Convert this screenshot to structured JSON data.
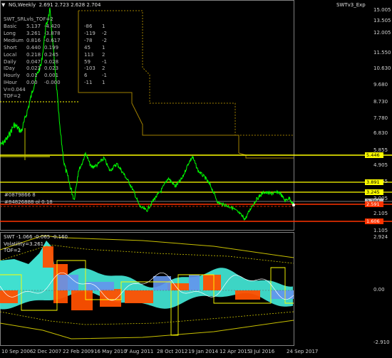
{
  "main_chart": {
    "title": "NG,Weekly  2.691 2.723 2.628 2.704",
    "indicator_label": "SWTv3_Exp",
    "overlay_title": "SWT_SRLvls_TOF=2",
    "stats_rows": [
      {
        "name": "Basic",
        "v1": "5.137",
        "v2": "-4.420",
        "v3": "-86",
        "v4": "1"
      },
      {
        "name": "Long",
        "v1": "3.261",
        "v2": "-3.878",
        "v3": "-119",
        "v4": "-2"
      },
      {
        "name": "Medium",
        "v1": "0.816",
        "v2": "-0.617",
        "v3": "-78",
        "v4": "-2"
      },
      {
        "name": "Short",
        "v1": "0.440",
        "v2": "0.199",
        "v3": "45",
        "v4": "1"
      },
      {
        "name": "Local",
        "v1": "0.218",
        "v2": "0.245",
        "v3": "113",
        "v4": "2"
      },
      {
        "name": "Daily",
        "v1": "0.047",
        "v2": "0.028",
        "v3": "59",
        "v4": "-1"
      },
      {
        "name": "IDay",
        "v1": "0.023",
        "v2": "0.023",
        "v3": "-103",
        "v4": "2"
      },
      {
        "name": "Hourly",
        "v1": "0.01",
        "v2": "0.001",
        "v3": "6",
        "v4": "-1"
      },
      {
        "name": "IHour",
        "v1": "0.00",
        "v2": "-0.000",
        "v3": "-11",
        "v4": "1"
      }
    ],
    "v_label": "V=0.044",
    "tof_label": "TOF=2",
    "cluster_labels": [
      "#0879866 8",
      "#84826888 ol 0.18"
    ],
    "y_ticks": [
      "15.005",
      "13.505",
      "12.005",
      "11.550",
      "10.630",
      "9.680",
      "8.730",
      "7.780",
      "6.830",
      "5.855",
      "4.905",
      "3.955",
      "3.005",
      "2.105",
      "1.105"
    ],
    "price_tags": [
      {
        "label": "5.446",
        "color": "#ffff00",
        "text_color": "#000000"
      },
      {
        "label": "3.891",
        "color": "#ffff00",
        "text_color": "#000000"
      },
      {
        "label": "3.245",
        "color": "#ffff00",
        "text_color": "#000000"
      },
      {
        "label": "2.704",
        "color": "#c0c0c0",
        "text_color": "#000000"
      },
      {
        "label": "2.591",
        "color": "#ff3300",
        "text_color": "#ffffff"
      },
      {
        "label": "1.606",
        "color": "#ff3300",
        "text_color": "#ffffff"
      }
    ]
  },
  "oscillator": {
    "title": "SWT -1.066 -0.065 -0.160",
    "volatility_label": "Volatility=3.261",
    "tof_label": "TOF=2",
    "y_ticks": [
      "2.924",
      "0.00",
      "-2.910"
    ]
  },
  "x_axis": {
    "labels": [
      "10 Sep 2006",
      "2 Dec 2007",
      "22 Feb 2009",
      "16 May 2010",
      "7 Aug 2011",
      "28 Oct 2012",
      "19 Jan 2014",
      "12 Apr 2015",
      "3 Jul 2016",
      "24 Sep 2017"
    ]
  },
  "colors": {
    "price_line": "#00ff00",
    "level_yellow": "#ffff00",
    "level_red": "#ff3300",
    "osc_cyan": "#40e0d0",
    "osc_orange": "#ff5000",
    "osc_blue": "#6495ed",
    "background": "#000000",
    "grid": "#404040"
  }
}
